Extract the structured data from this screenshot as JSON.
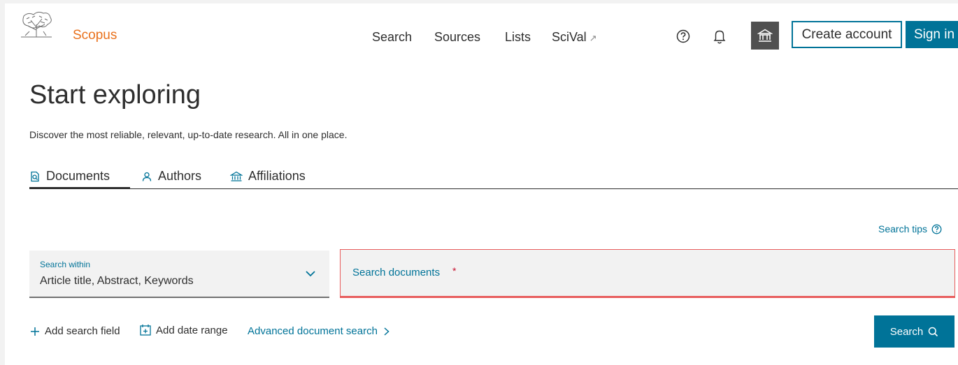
{
  "header": {
    "brand": "Scopus",
    "nav": [
      {
        "label": "Search"
      },
      {
        "label": "Sources"
      },
      {
        "label": "Lists"
      },
      {
        "label": "SciVal"
      }
    ],
    "scival_ext_glyph": "↗",
    "create_account": "Create account",
    "sign_in": "Sign in"
  },
  "page": {
    "title": "Start exploring",
    "subtitle": "Discover the most reliable, relevant, up-to-date research. All in one place."
  },
  "tabs": [
    {
      "label": "Documents",
      "icon": "document-search-icon",
      "active": true
    },
    {
      "label": "Authors",
      "icon": "person-icon",
      "active": false
    },
    {
      "label": "Affiliations",
      "icon": "institution-icon",
      "active": false
    }
  ],
  "search": {
    "tips_label": "Search tips",
    "within_label": "Search within",
    "within_value": "Article title, Abstract, Keywords",
    "documents_placeholder": "Search documents",
    "required_mark": "*",
    "add_field": "Add search field",
    "add_date": "Add date range",
    "advanced": "Advanced document search",
    "button": "Search"
  },
  "colors": {
    "accent": "#007398",
    "brand": "#e9711c",
    "error": "#e85c5c",
    "institution_bg": "#505050"
  }
}
